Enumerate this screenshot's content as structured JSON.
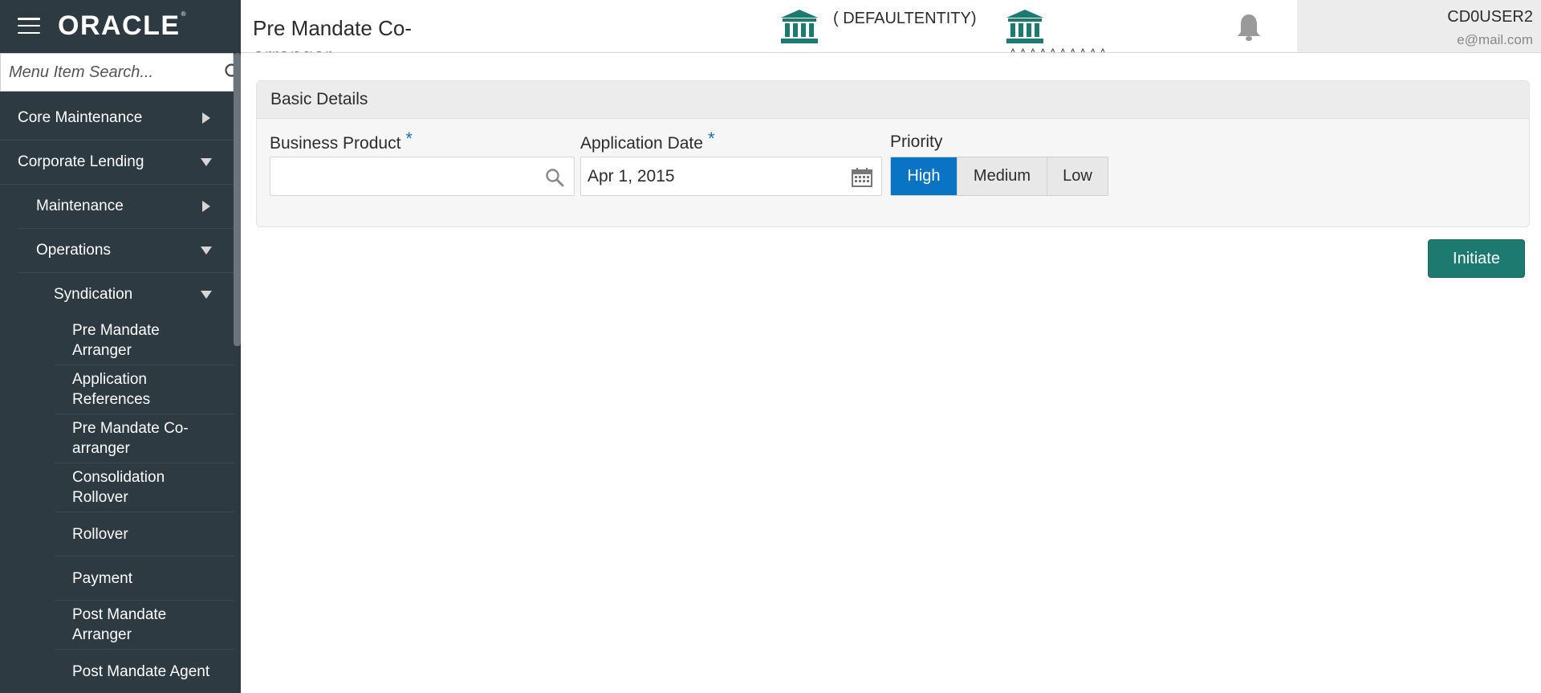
{
  "brand": {
    "logo_text": "ORACLE",
    "trademark": "®"
  },
  "search": {
    "placeholder": "Menu Item Search..."
  },
  "sidebar": {
    "core_maintenance": "Core Maintenance",
    "corporate_lending": "Corporate Lending",
    "maintenance": "Maintenance",
    "operations": "Operations",
    "syndication": "Syndication",
    "leaves": [
      {
        "line1": "Pre Mandate",
        "line2": "Arranger"
      },
      {
        "line1": "Application",
        "line2": "References"
      },
      {
        "line1": "Pre Mandate Co-",
        "line2": "arranger"
      },
      {
        "line1": "Consolidation",
        "line2": "Rollover"
      },
      {
        "line1": "Rollover"
      },
      {
        "line1": "Payment"
      },
      {
        "line1": "Post Mandate",
        "line2": "Arranger"
      },
      {
        "line1": "Post Mandate Agent"
      }
    ]
  },
  "header": {
    "page_title": "Pre Mandate Co-arranger",
    "entity": "( DEFAULTENTITY)",
    "branch_partial": "ѧ ѧ ѧ ѧ ѧ ѧ ѧ ѧ ѧ ѧ",
    "user_name": "CD0USER2",
    "user_email": "e@mail.com"
  },
  "form": {
    "section_title": "Basic Details",
    "business_product_label": "Business Product",
    "business_product_value": "",
    "application_date_label": "Application Date",
    "application_date_value": "Apr 1, 2015",
    "priority_label": "Priority",
    "required_mark": "*",
    "priority_options": [
      "High",
      "Medium",
      "Low"
    ],
    "priority_selected": "High"
  },
  "actions": {
    "initiate_label": "Initiate"
  },
  "colors": {
    "sidebar_bg": "#2e3a42",
    "accent_blue": "#0a74c4",
    "teal_button": "#1d7a71",
    "bank_icon": "#1d7a71",
    "required_star": "#1f6fb2"
  }
}
